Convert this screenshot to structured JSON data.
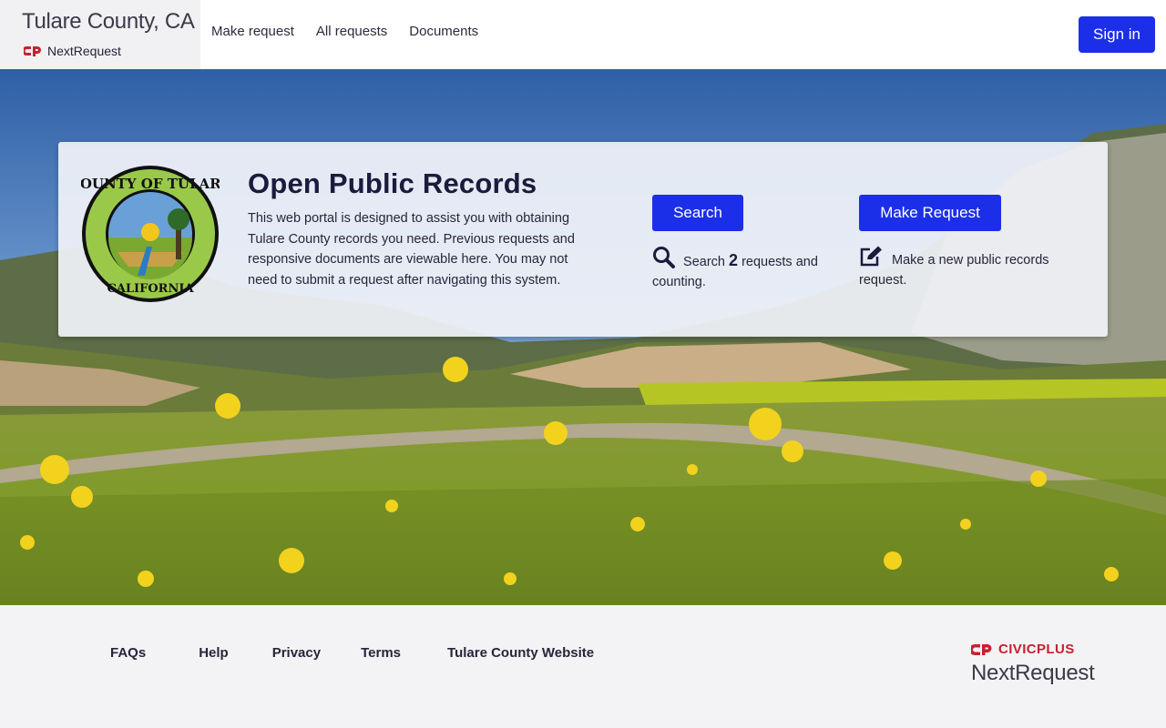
{
  "header": {
    "org_name": "Tulare County, CA",
    "product_name": "NextRequest",
    "nav": [
      "Make request",
      "All requests",
      "Documents"
    ],
    "sign_in": "Sign in"
  },
  "hero": {
    "title": "Open Public Records",
    "description": "This web portal is designed to assist you with obtaining Tulare County records you need. Previous requests and responsive documents are viewable here. You may not need to submit a request after navigating this system.",
    "seal_text": "COUNTY OF TULARE · CALIFORNIA",
    "search_button": "Search",
    "search_prefix": "Search",
    "search_count": "2",
    "search_suffix": "requests and counting.",
    "make_button": "Make Request",
    "make_text": "Make a new public records request."
  },
  "footer": {
    "links": [
      "FAQs",
      "Help",
      "Privacy",
      "Terms",
      "Tulare County Website"
    ],
    "brand_top": "CIVICPLUS",
    "brand_bottom": "NextRequest"
  },
  "colors": {
    "accent": "#1c2fe8",
    "brand_red": "#c8202f"
  },
  "icons": [
    "nextrequest-logo-icon",
    "search-icon",
    "edit-icon",
    "civicplus-logo-icon",
    "county-seal-icon"
  ]
}
